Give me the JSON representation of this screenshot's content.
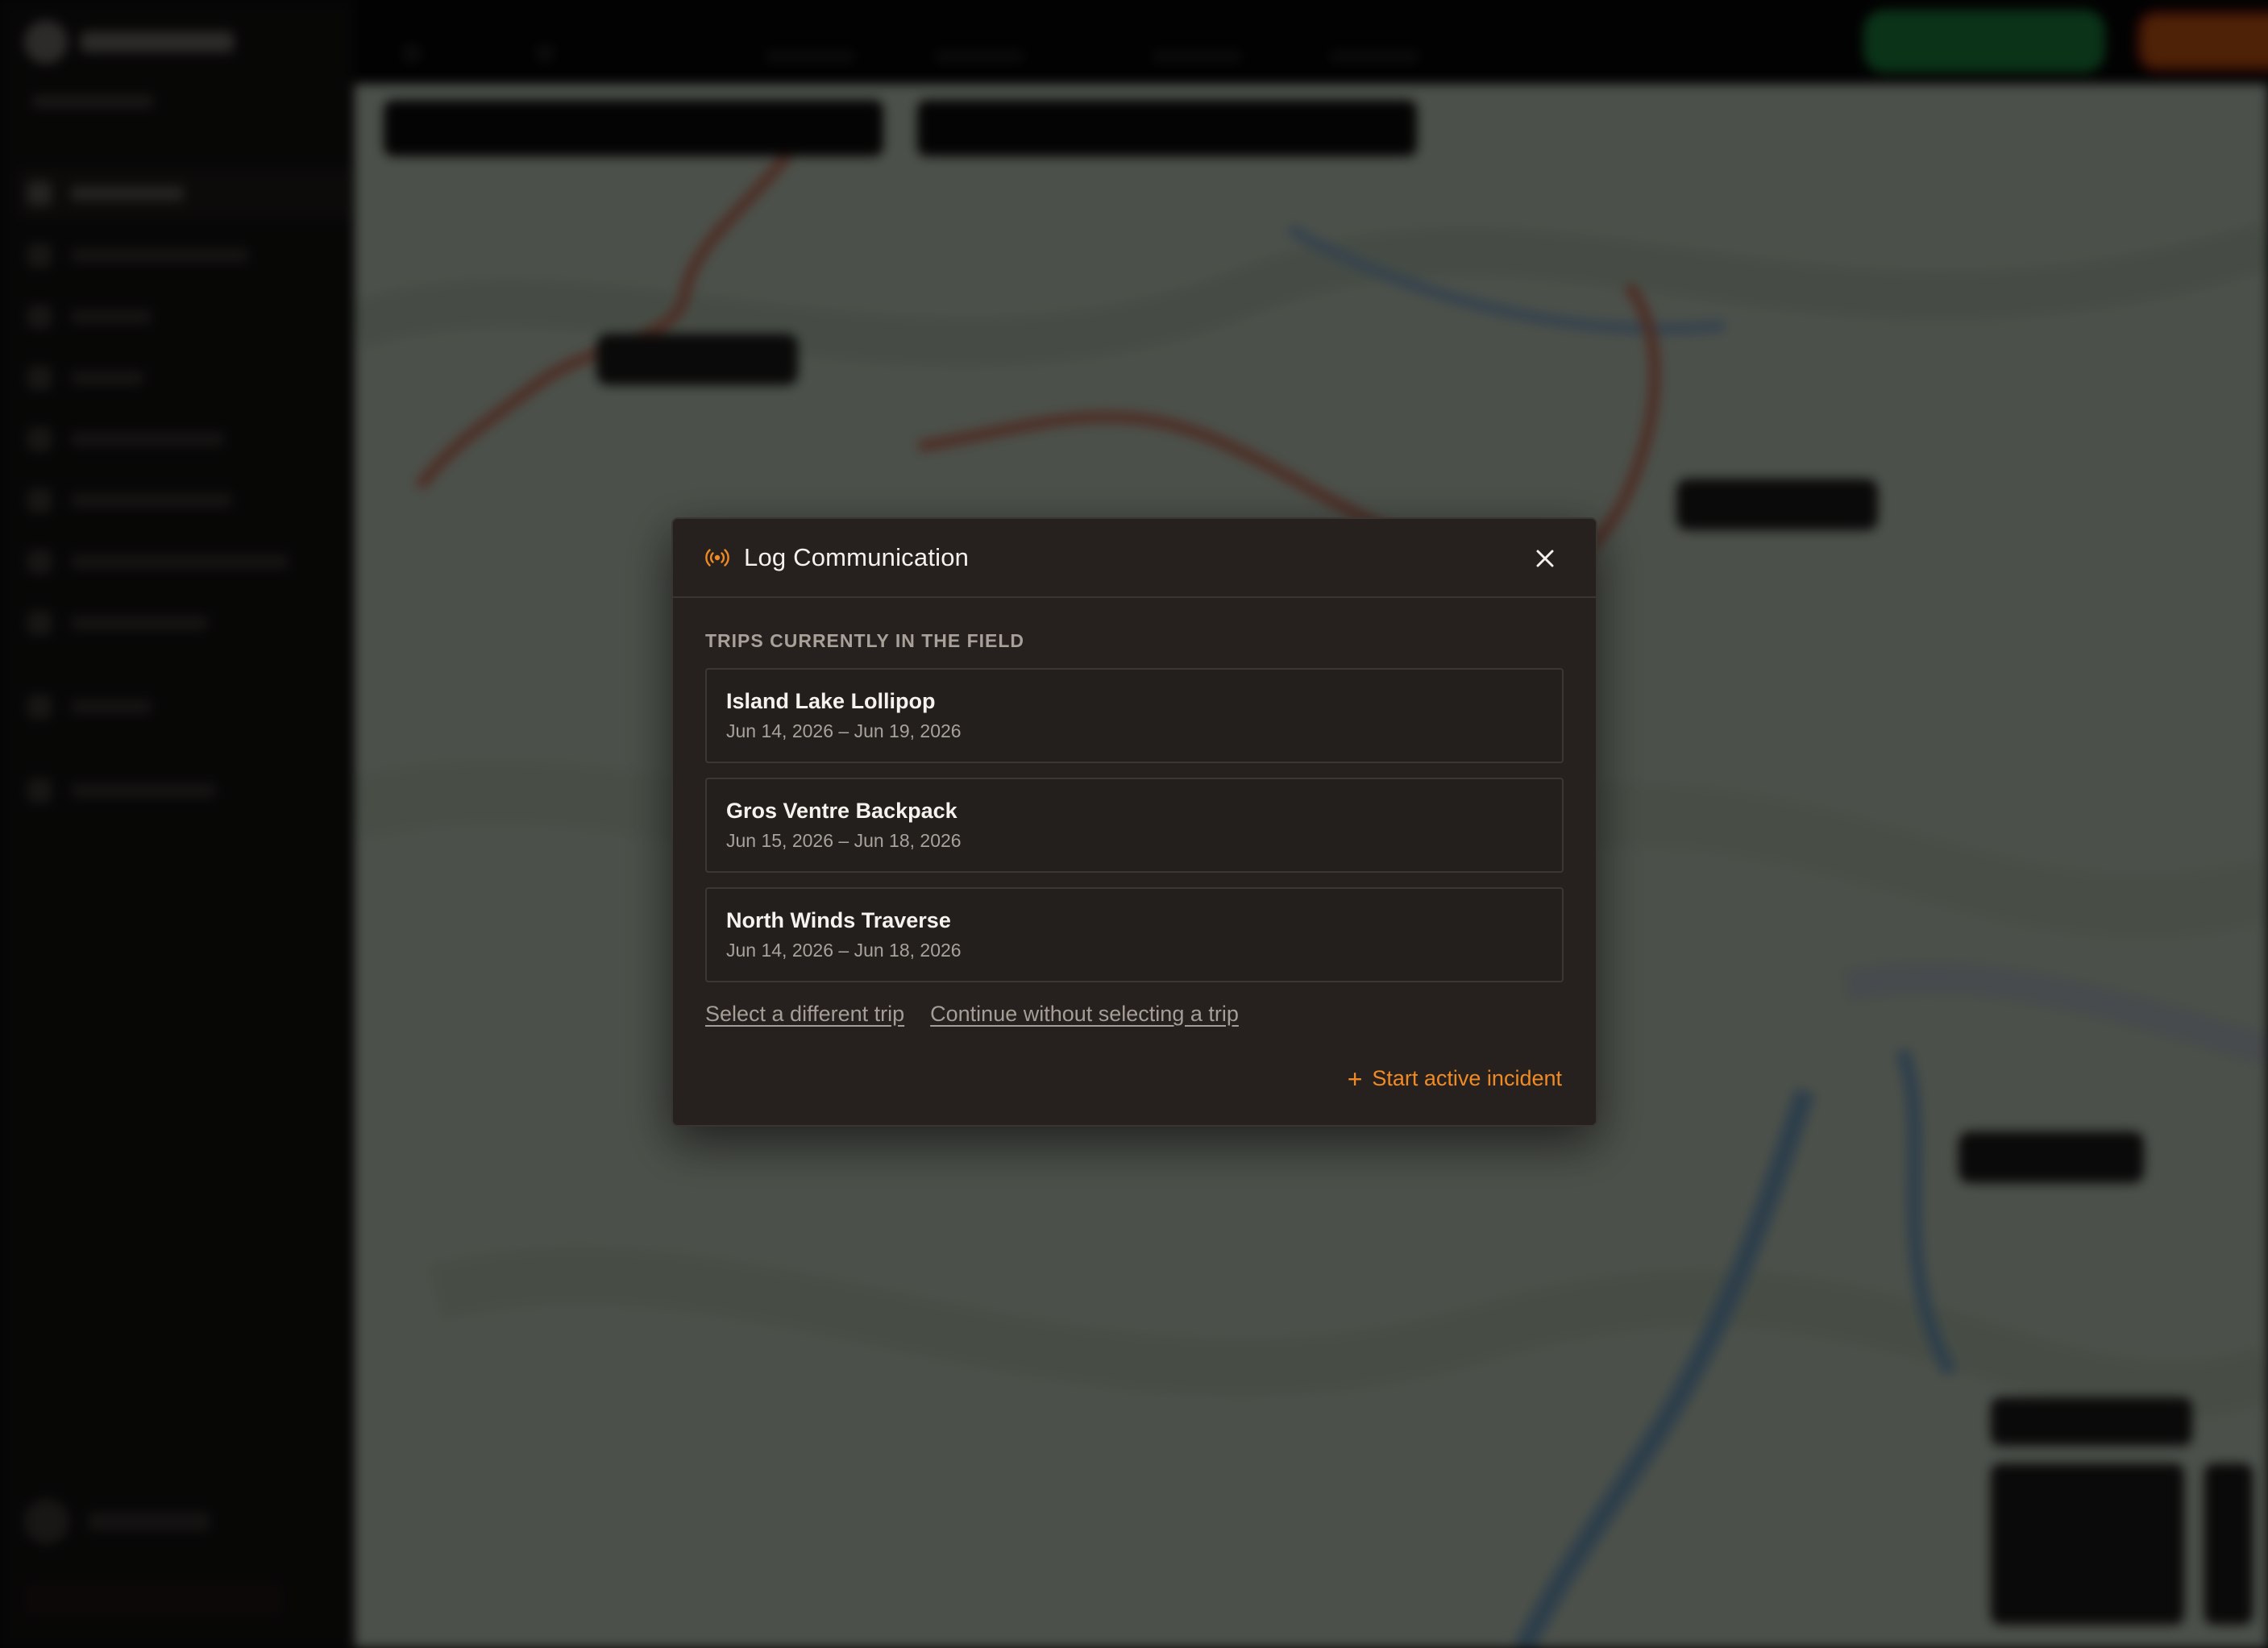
{
  "modal": {
    "title": "Log Communication",
    "icon": "broadcast-icon",
    "section_label": "TRIPS CURRENTLY IN THE FIELD",
    "trips": [
      {
        "name": "Island Lake Lollipop",
        "dates": "Jun 14, 2026 – Jun 19, 2026"
      },
      {
        "name": "Gros Ventre Backpack",
        "dates": "Jun 15, 2026 – Jun 18, 2026"
      },
      {
        "name": "North Winds Traverse",
        "dates": "Jun 14, 2026 – Jun 18, 2026"
      }
    ],
    "select_different_trip": "Select a different trip",
    "continue_without_trip": "Continue without selecting a trip",
    "start_incident": "Start active incident",
    "close_icon": "close-icon",
    "accent_color": "#f08a24"
  }
}
